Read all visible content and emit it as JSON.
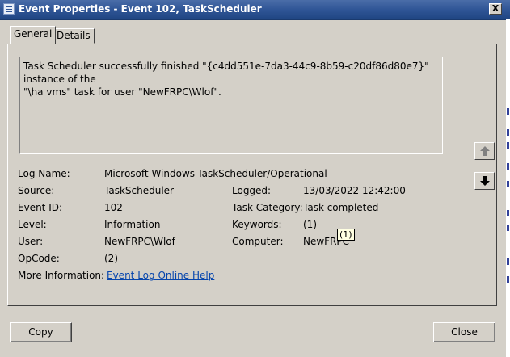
{
  "window": {
    "title": "Event Properties - Event 102, TaskScheduler",
    "close_label": "X"
  },
  "tabs": [
    {
      "label": "General",
      "active": true
    },
    {
      "label": "Details",
      "active": false
    }
  ],
  "description": {
    "line1": "Task Scheduler successfully finished \"{c4dd551e-7da3-44c9-8b59-c20df86d80e7}\" instance of the",
    "line2": "\"\\ha vms\" task for user \"NewFRPC\\Wlof\"."
  },
  "fields": {
    "log_name": {
      "label": "Log Name:",
      "value": "Microsoft-Windows-TaskScheduler/Operational"
    },
    "source": {
      "label": "Source:",
      "value": "TaskScheduler"
    },
    "logged": {
      "label": "Logged:",
      "value": "13/03/2022 12:42:00"
    },
    "event_id": {
      "label": "Event ID:",
      "value": "102"
    },
    "task_category": {
      "label": "Task Category:",
      "value": "Task completed"
    },
    "level": {
      "label": "Level:",
      "value": "Information"
    },
    "keywords": {
      "label": "Keywords:",
      "value": "(1)"
    },
    "user": {
      "label": "User:",
      "value": "NewFRPC\\Wlof"
    },
    "computer": {
      "label": "Computer:",
      "value": "NewFRPC"
    },
    "opcode": {
      "label": "OpCode:",
      "value": "(2)"
    },
    "more_info": {
      "label": "More Information:",
      "link": "Event Log Online Help"
    }
  },
  "tooltip": "(1)",
  "nav": {
    "up_icon": "arrow-up-icon",
    "down_icon": "arrow-down-icon"
  },
  "buttons": {
    "copy": "Copy",
    "close": "Close"
  },
  "colors": {
    "titlebar": "#2f5596",
    "face": "#d4d0c8",
    "link": "#0645ad",
    "tooltip_bg": "#ffffe1"
  }
}
